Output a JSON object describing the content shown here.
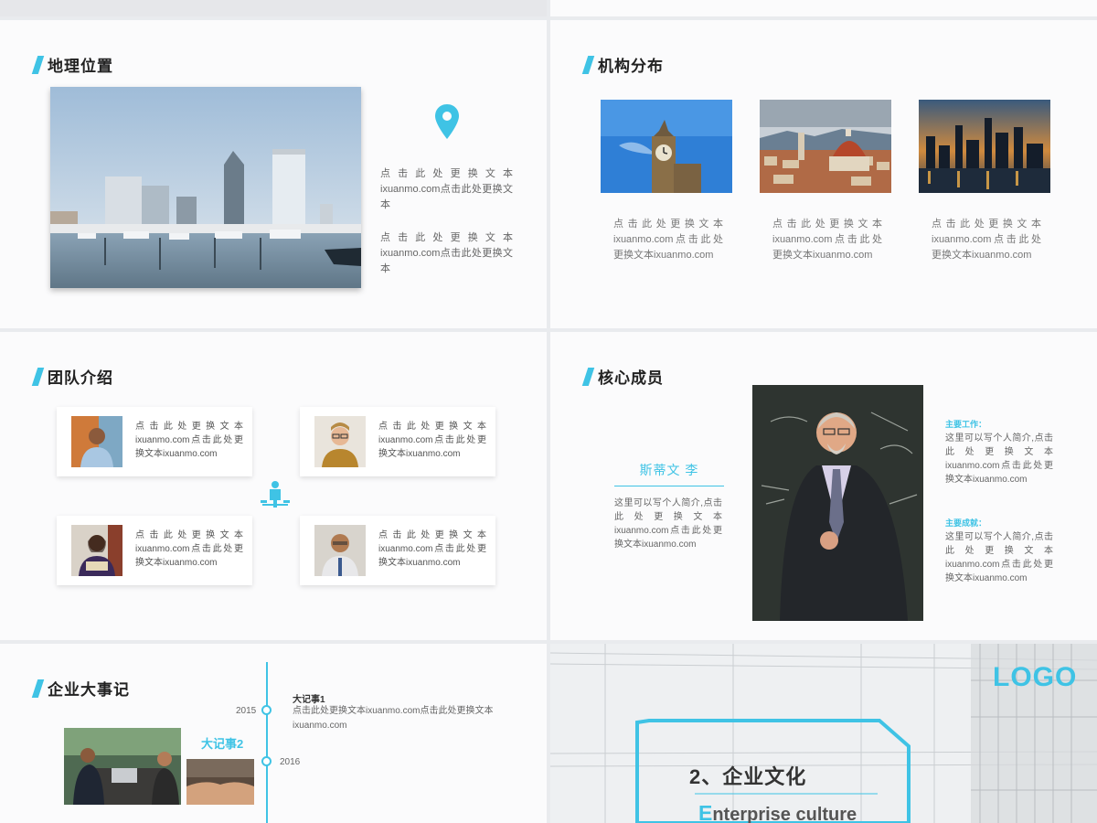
{
  "slide_geo": {
    "title": "地理位置",
    "text1": "点击此处更换文本ixuanmo.com点击此处更换文本",
    "text2": "点击此处更换文本ixuanmo.com点击此处更换文本"
  },
  "slide_org": {
    "title": "机构分布",
    "captions": [
      "点击此处更换文本ixuanmo.com点击此处更换文本ixuanmo.com",
      "点击此处更换文本ixuanmo.com点击此处更换文本ixuanmo.com",
      "点击此处更换文本ixuanmo.com点击此处更换文本ixuanmo.com"
    ]
  },
  "slide_team": {
    "title": "团队介绍",
    "cards": [
      "点击此处更换文本ixuanmo.com点击此处更换文本ixuanmo.com",
      "点击此处更换文本ixuanmo.com点击此处更换文本ixuanmo.com",
      "点击此处更换文本ixuanmo.com点击此处更换文本ixuanmo.com",
      "点击此处更换文本ixuanmo.com点击此处更换文本ixuanmo.com"
    ]
  },
  "slide_core": {
    "title": "核心成员",
    "name": "斯蒂文 李",
    "bio": "这里可以写个人简介,点击此处更换文本ixuanmo.com点击此处更换文本ixuanmo.com",
    "work_heading": "主要工作：",
    "work_text": "这里可以写个人简介,点击此处更换文本ixuanmo.com点击此处更换文本ixuanmo.com",
    "achieve_heading": "主要成就：",
    "achieve_text": "这里可以写个人简介,点击此处更换文本ixuanmo.com点击此处更换文本ixuanmo.com"
  },
  "slide_events": {
    "title": "企业大事记",
    "years": [
      "2015",
      "2016"
    ],
    "event1_title": "大记事1",
    "event1_text": "点击此处更换文本ixuanmo.com点击此处更换文本ixuanmo.com",
    "event2_title": "大记事2"
  },
  "slide_culture": {
    "logo": "LOGO",
    "section_title": "2、企业文化",
    "subtitle_first": "E",
    "subtitle_rest": "nterprise culture"
  },
  "colors": {
    "accent": "#3fc3e5",
    "text": "#666666",
    "title": "#222222"
  }
}
